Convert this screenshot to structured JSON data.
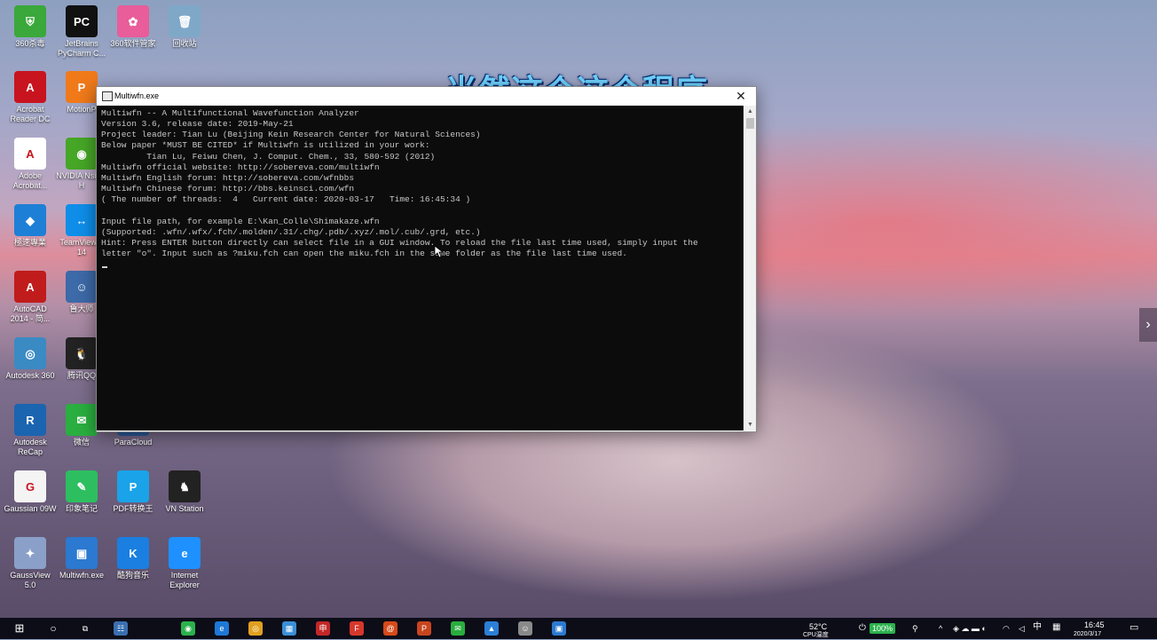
{
  "desktop": {
    "icons": [
      {
        "label": "360杀毒",
        "glyph": "⛨",
        "color": "#3aa83a"
      },
      {
        "label": "JetBrains PyCharm C...",
        "glyph": "PC",
        "color": "#111111"
      },
      {
        "label": "360软件管家",
        "glyph": "✿",
        "color": "#e85d9a"
      },
      {
        "label": "回收站",
        "glyph": "🗑",
        "color": "#7fa8c8"
      },
      {
        "label": "Acrobat Reader DC",
        "glyph": "A",
        "color": "#c8141e"
      },
      {
        "label": "MotionP",
        "glyph": "P",
        "color": "#f07a1a"
      },
      {
        "label": "Adobe Acrobat...",
        "glyph": "A",
        "color": "#ffffff"
      },
      {
        "label": "NVIDIA Nsight H",
        "glyph": "◉",
        "color": "#46a626"
      },
      {
        "label": "極速專業",
        "glyph": "◆",
        "color": "#1e7fd6"
      },
      {
        "label": "TeamViewer 14",
        "glyph": "↔",
        "color": "#0e8ee9"
      },
      {
        "label": "AutoCAD 2014 - 简...",
        "glyph": "A",
        "color": "#c01c1c"
      },
      {
        "label": "鲁大师",
        "glyph": "☺",
        "color": "#3d6aa8"
      },
      {
        "label": "Autodesk 360",
        "glyph": "◎",
        "color": "#3a8ac4"
      },
      {
        "label": "腾讯QQ",
        "glyph": "🐧",
        "color": "#222222"
      },
      {
        "label": "Autodesk ReCap",
        "glyph": "R",
        "color": "#1b64b0"
      },
      {
        "label": "微信",
        "glyph": "✉",
        "color": "#2aae3f"
      },
      {
        "label": "ParaCloud",
        "glyph": "☁",
        "color": "#2a5a9a"
      },
      {
        "label": "Gaussian 09W",
        "glyph": "G",
        "color": "#f4f4f4"
      },
      {
        "label": "印象笔记",
        "glyph": "✎",
        "color": "#2dbe60"
      },
      {
        "label": "PDF转换王",
        "glyph": "P",
        "color": "#1aa3e8"
      },
      {
        "label": "VN Station",
        "glyph": "♞",
        "color": "#222222"
      },
      {
        "label": "GaussView 5.0",
        "glyph": "✦",
        "color": "#8aa0c8"
      },
      {
        "label": "Multiwfn.exe",
        "glyph": "▣",
        "color": "#2b79d0"
      },
      {
        "label": "酷狗音乐",
        "glyph": "K",
        "color": "#1a7fe0"
      },
      {
        "label": "Internet Explorer",
        "glyph": "e",
        "color": "#1e90ff"
      }
    ]
  },
  "caption": "当然这个这个程序",
  "console": {
    "title": "Multiwfn.exe",
    "close_glyph": "✕",
    "text": "Multiwfn -- A Multifunctional Wavefunction Analyzer\nVersion 3.6, release date: 2019-May-21\nProject leader: Tian Lu (Beijing Kein Research Center for Natural Sciences)\nBelow paper *MUST BE CITED* if Multiwfn is utilized in your work:\n         Tian Lu, Feiwu Chen, J. Comput. Chem., 33, 580-592 (2012)\nMultiwfn official website: http://sobereva.com/multiwfn\nMultiwfn English forum: http://sobereva.com/wfnbbs\nMultiwfn Chinese forum: http://bbs.keinsci.com/wfn\n( The number of threads:  4   Current date: 2020-03-17   Time: 16:45:34 )\n\nInput file path, for example E:\\Kan_Colle\\Shimakaze.wfn\n(Supported: .wfn/.wfx/.fch/.molden/.31/.chg/.pdb/.xyz/.mol/.cub/.grd, etc.)\nHint: Press ENTER button directly can select file in a GUI window. To reload the file last time used, simply input the\nletter \"o\". Input such as ?miku.fch can open the miku.fch in the same folder as the file last time used."
  },
  "side_arrow": "›",
  "taskbar": {
    "start_glyph": "⊞",
    "search_glyph": "○",
    "taskview_glyph": "⧉",
    "apps": [
      {
        "name": "app-1",
        "glyph": "☷",
        "color": "#3a6fb0"
      },
      {
        "name": "app-2",
        "glyph": "◉",
        "color": "#2bb24c"
      },
      {
        "name": "edge",
        "glyph": "e",
        "color": "#1e78d7"
      },
      {
        "name": "chrome",
        "glyph": "◎",
        "color": "#e0a020"
      },
      {
        "name": "app-5",
        "glyph": "▦",
        "color": "#3a8fd6"
      },
      {
        "name": "app-6",
        "glyph": "申",
        "color": "#c22727"
      },
      {
        "name": "foxit",
        "glyph": "F",
        "color": "#d6382c"
      },
      {
        "name": "app-8",
        "glyph": "@",
        "color": "#d64a1a"
      },
      {
        "name": "powerpoint",
        "glyph": "P",
        "color": "#c8451f"
      },
      {
        "name": "wechat",
        "glyph": "✉",
        "color": "#2aae3f"
      },
      {
        "name": "app-11",
        "glyph": "▲",
        "color": "#2a7fd6"
      },
      {
        "name": "app-12",
        "glyph": "☺",
        "color": "#8a8a8a"
      },
      {
        "name": "multiwfn",
        "glyph": "▣",
        "color": "#2b79d0"
      }
    ],
    "temperature": "52°C",
    "cpu_label": "CPU温度",
    "battery": "100%",
    "ime": "中",
    "time": "16:45",
    "date": "2020/3/17"
  }
}
